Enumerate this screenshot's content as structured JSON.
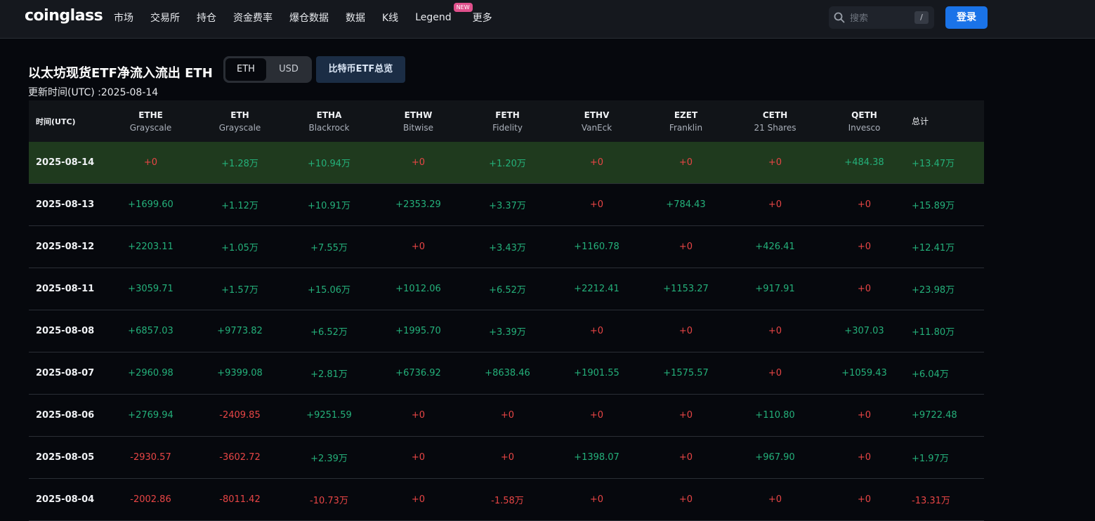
{
  "header": {
    "logo": "coinglass",
    "nav": [
      {
        "label": "市场"
      },
      {
        "label": "交易所"
      },
      {
        "label": "持仓"
      },
      {
        "label": "资金费率"
      },
      {
        "label": "爆仓数据"
      },
      {
        "label": "数据"
      },
      {
        "label": "K线"
      },
      {
        "label": "Legend",
        "badge": "NEW"
      },
      {
        "label": "更多"
      }
    ],
    "search": {
      "placeholder": "搜索",
      "shortcut": "/"
    },
    "login_label": "登录"
  },
  "page": {
    "title": "以太坊现货ETF净流入流出 ETH",
    "toggle": {
      "active": "ETH",
      "inactive": "USD"
    },
    "btc_overview_label": "比特币ETF总览",
    "update_time": "更新时间(UTC) :2025-08-14"
  },
  "table": {
    "date_header": "时间(UTC)",
    "total_header": "总计",
    "columns": [
      {
        "ticker": "ETHE",
        "issuer": "Grayscale"
      },
      {
        "ticker": "ETH",
        "issuer": "Grayscale"
      },
      {
        "ticker": "ETHA",
        "issuer": "Blackrock"
      },
      {
        "ticker": "ETHW",
        "issuer": "Bitwise"
      },
      {
        "ticker": "FETH",
        "issuer": "Fidelity"
      },
      {
        "ticker": "ETHV",
        "issuer": "VanEck"
      },
      {
        "ticker": "EZET",
        "issuer": "Franklin"
      },
      {
        "ticker": "CETH",
        "issuer": "21 Shares"
      },
      {
        "ticker": "QETH",
        "issuer": "Invesco"
      }
    ],
    "rows": [
      {
        "date": "2025-08-14",
        "values": [
          "+0",
          "+1.28万",
          "+10.94万",
          "+0",
          "+1.20万",
          "+0",
          "+0",
          "+0",
          "+484.38"
        ],
        "total": "+13.47万"
      },
      {
        "date": "2025-08-13",
        "values": [
          "+1699.60",
          "+1.12万",
          "+10.91万",
          "+2353.29",
          "+3.37万",
          "+0",
          "+784.43",
          "+0",
          "+0"
        ],
        "total": "+15.89万"
      },
      {
        "date": "2025-08-12",
        "values": [
          "+2203.11",
          "+1.05万",
          "+7.55万",
          "+0",
          "+3.43万",
          "+1160.78",
          "+0",
          "+426.41",
          "+0"
        ],
        "total": "+12.41万"
      },
      {
        "date": "2025-08-11",
        "values": [
          "+3059.71",
          "+1.57万",
          "+15.06万",
          "+1012.06",
          "+6.52万",
          "+2212.41",
          "+1153.27",
          "+917.91",
          "+0"
        ],
        "total": "+23.98万"
      },
      {
        "date": "2025-08-08",
        "values": [
          "+6857.03",
          "+9773.82",
          "+6.52万",
          "+1995.70",
          "+3.39万",
          "+0",
          "+0",
          "+0",
          "+307.03"
        ],
        "total": "+11.80万"
      },
      {
        "date": "2025-08-07",
        "values": [
          "+2960.98",
          "+9399.08",
          "+2.81万",
          "+6736.92",
          "+8638.46",
          "+1901.55",
          "+1575.57",
          "+0",
          "+1059.43"
        ],
        "total": "+6.04万"
      },
      {
        "date": "2025-08-06",
        "values": [
          "+2769.94",
          "-2409.85",
          "+9251.59",
          "+0",
          "+0",
          "+0",
          "+0",
          "+110.80",
          "+0"
        ],
        "total": "+9722.48"
      },
      {
        "date": "2025-08-05",
        "values": [
          "-2930.57",
          "-3602.72",
          "+2.39万",
          "+0",
          "+0",
          "+1398.07",
          "+0",
          "+967.90",
          "+0"
        ],
        "total": "+1.97万"
      },
      {
        "date": "2025-08-04",
        "values": [
          "-2002.86",
          "-8011.42",
          "-10.73万",
          "+0",
          "-1.58万",
          "+0",
          "+0",
          "+0",
          "+0"
        ],
        "total": "-13.31万"
      }
    ]
  },
  "colors": {
    "positive": "#24b07a",
    "negative": "#e84545",
    "highlight_row": "#1f3a1e",
    "accent": "#1a73e8"
  }
}
